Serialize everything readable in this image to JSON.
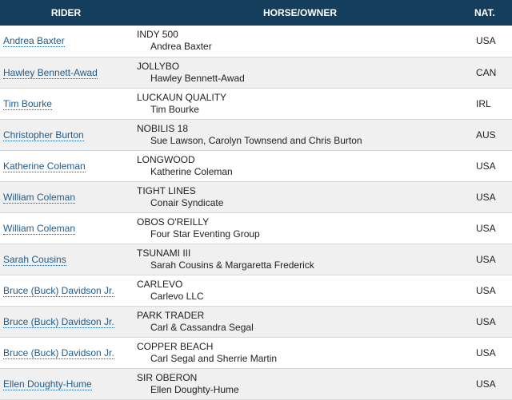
{
  "table": {
    "headers": {
      "rider": "RIDER",
      "horse_owner": "HORSE/OWNER",
      "nat": "NAT."
    },
    "rows": [
      {
        "rider": "Andrea Baxter",
        "horse": "INDY 500",
        "owner": "Andrea Baxter",
        "nat": "USA"
      },
      {
        "rider": "Hawley Bennett-Awad",
        "horse": "JOLLYBO",
        "owner": "Hawley Bennett-Awad",
        "nat": "CAN"
      },
      {
        "rider": "Tim Bourke",
        "horse": "LUCKAUN QUALITY",
        "owner": "Tim Bourke",
        "nat": "IRL"
      },
      {
        "rider": "Christopher Burton",
        "horse": "NOBILIS 18",
        "owner": "Sue Lawson, Carolyn Townsend and Chris Burton",
        "nat": "AUS"
      },
      {
        "rider": "Katherine Coleman",
        "horse": "LONGWOOD",
        "owner": "Katherine Coleman",
        "nat": "USA"
      },
      {
        "rider": "William Coleman",
        "horse": "TIGHT LINES",
        "owner": "Conair Syndicate",
        "nat": "USA"
      },
      {
        "rider": "William Coleman",
        "horse": "OBOS O'REILLY",
        "owner": "Four Star Eventing Group",
        "nat": "USA"
      },
      {
        "rider": "Sarah Cousins",
        "horse": "TSUNAMI III",
        "owner": "Sarah Cousins & Margaretta Frederick",
        "nat": "USA"
      },
      {
        "rider": "Bruce (Buck) Davidson Jr.",
        "horse": "CARLEVO",
        "owner": "Carlevo LLC",
        "nat": "USA"
      },
      {
        "rider": "Bruce (Buck) Davidson Jr.",
        "horse": "PARK TRADER",
        "owner": "Carl & Cassandra Segal",
        "nat": "USA"
      },
      {
        "rider": "Bruce (Buck) Davidson Jr.",
        "horse": "COPPER BEACH",
        "owner": "Carl Segal and Sherrie Martin",
        "nat": "USA"
      },
      {
        "rider": "Ellen Doughty-Hume",
        "horse": "SIR OBERON",
        "owner": "Ellen Doughty-Hume",
        "nat": "USA"
      }
    ]
  },
  "colors": {
    "header_bg": "#153e5c",
    "header_text": "#ffffff",
    "link": "#1e5b8c",
    "stripe": "#f0f0f0"
  }
}
